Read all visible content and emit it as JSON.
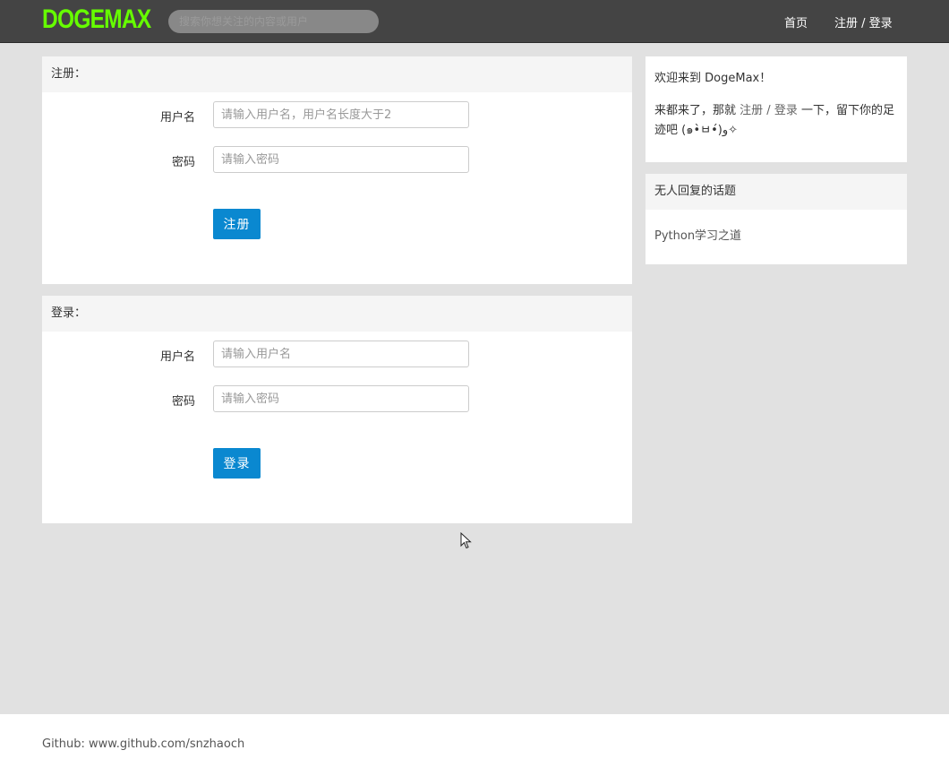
{
  "header": {
    "logo": "DOGEMAX",
    "search_placeholder": "搜索你想关注的内容或用户",
    "nav_home": "首页",
    "nav_auth": "注册 / 登录"
  },
  "register": {
    "title": "注册：",
    "username_label": "用户名",
    "username_placeholder": "请输入用户名，用户名长度大于2",
    "password_label": "密码",
    "password_placeholder": "请输入密码",
    "submit_label": "注册"
  },
  "login": {
    "title": "登录：",
    "username_label": "用户名",
    "username_placeholder": "请输入用户名",
    "password_label": "密码",
    "password_placeholder": "请输入密码",
    "submit_label": "登录"
  },
  "welcome": {
    "greeting": "欢迎来到 DogeMax！",
    "text_before": "来都来了，那就 ",
    "link_register": "注册",
    "link_sep": " / ",
    "link_login": "登录",
    "text_after": " 一下，留下你的足迹吧 (๑•̀ㅂ•́)و✧"
  },
  "topics": {
    "title": "无人回复的话题",
    "items": [
      "Python学习之道"
    ]
  },
  "footer": {
    "text": "Github: www.github.com/snzhaoch"
  },
  "colors": {
    "accent": "#0a88d0",
    "logo": "#66ff00",
    "navbar": "#444444",
    "background": "#e1e1e1"
  }
}
